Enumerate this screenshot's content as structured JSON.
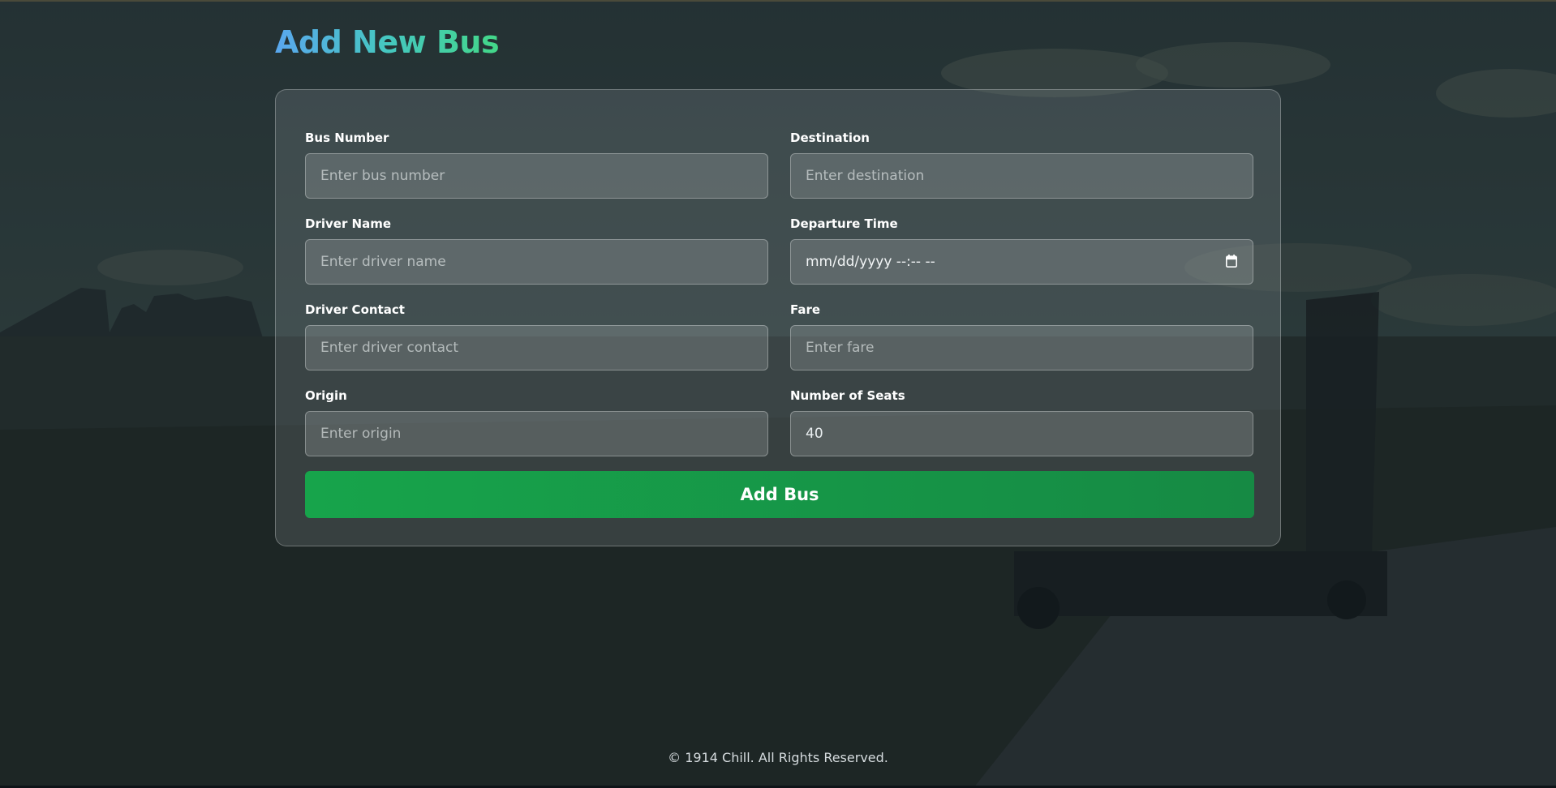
{
  "page": {
    "title": "Add New Bus"
  },
  "form": {
    "fields": [
      {
        "label": "Bus Number",
        "placeholder": "Enter bus number",
        "value": ""
      },
      {
        "label": "Destination",
        "placeholder": "Enter destination",
        "value": ""
      },
      {
        "label": "Driver Name",
        "placeholder": "Enter driver name",
        "value": ""
      },
      {
        "label": "Departure Time",
        "placeholder": "",
        "value": "mm/dd/yyyy --:-- --"
      },
      {
        "label": "Driver Contact",
        "placeholder": "Enter driver contact",
        "value": ""
      },
      {
        "label": "Fare",
        "placeholder": "Enter fare",
        "value": ""
      },
      {
        "label": "Origin",
        "placeholder": "Enter origin",
        "value": ""
      },
      {
        "label": "Number of Seats",
        "placeholder": "",
        "value": "40"
      }
    ],
    "submit_label": "Add Bus"
  },
  "footer": {
    "text": "© 1914 Chill. All Rights Reserved."
  },
  "colors": {
    "title_gradient": [
      "#5aa7ee",
      "#45c7c0",
      "#43d788"
    ],
    "submit_button": "#17a44b",
    "background_overlay": "#1f2a2e"
  },
  "icons": {
    "date_picker": "calendar-icon"
  }
}
